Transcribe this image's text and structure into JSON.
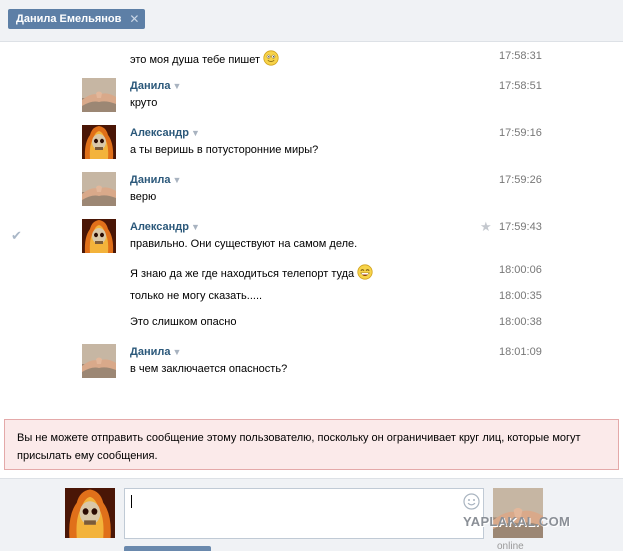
{
  "header": {
    "contact_chip": "Данила Емельянов",
    "close_glyph": "✕"
  },
  "messages": [
    {
      "text": "это моя душа тебе пишет",
      "time": "17:58:31",
      "emoji": "smile"
    },
    {
      "author": "Данила",
      "avatar": "danila",
      "text": "круто",
      "time": "17:58:51"
    },
    {
      "author": "Александр",
      "avatar": "aleksandr",
      "text": "а ты веришь в потусторонние миры?",
      "time": "17:59:16"
    },
    {
      "author": "Данила",
      "avatar": "danila",
      "text": "верю",
      "time": "17:59:26"
    },
    {
      "author": "Александр",
      "avatar": "aleksandr",
      "text": "правильно. Они существуют на самом деле.",
      "time": "17:59:43",
      "checked": true,
      "starred": true
    },
    {
      "text": "Я знаю да же где находиться телепорт туда",
      "time": "18:00:06",
      "emoji": "laugh"
    },
    {
      "text": "только не могу сказать.....",
      "time": "18:00:35"
    },
    {
      "text": "Это слишком опасно",
      "time": "18:00:38"
    },
    {
      "author": "Данила",
      "avatar": "danila",
      "text": "в чем заключается опасность?",
      "time": "18:01:09"
    }
  ],
  "warning": {
    "line1": "Вы не можете отправить сообщение этому пользователю, поскольку он ограничивает круг лиц, которые могут",
    "line2": "присылать ему сообщения."
  },
  "composer": {
    "value": "",
    "peer_status": "online"
  },
  "watermark": "YAPLAKAL.COM",
  "colors": {
    "author": "#2b587a",
    "chip": "#5d7fa6",
    "warning_bg": "#fbeaea",
    "warning_border": "#e4a9a9"
  }
}
